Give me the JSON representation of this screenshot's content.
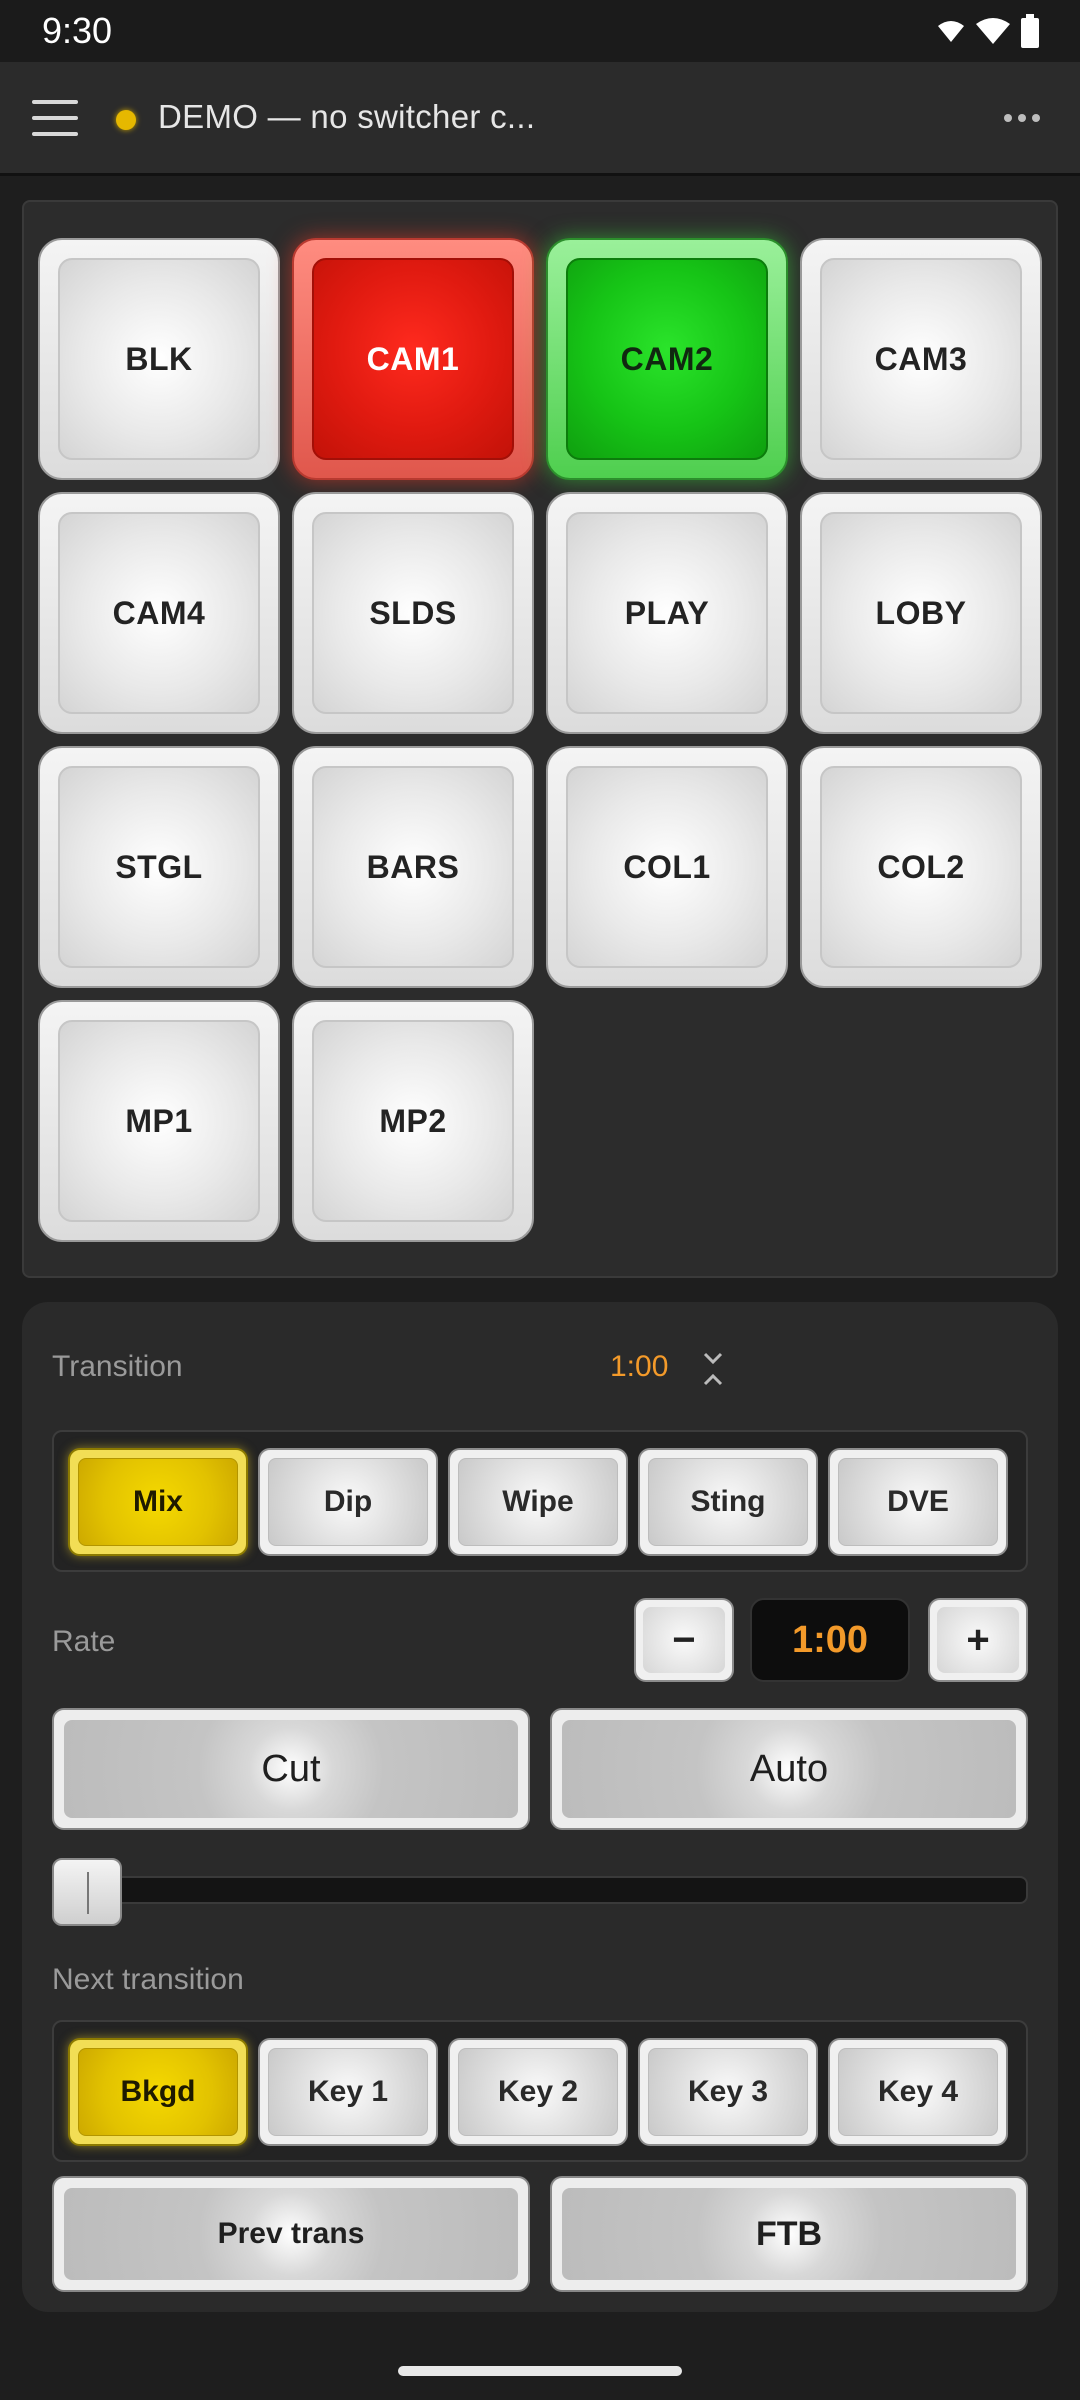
{
  "status_bar": {
    "time": "9:30",
    "icons": [
      "wifi-icon",
      "signal-icon",
      "battery-icon"
    ]
  },
  "app_bar": {
    "title": "DEMO — no switcher c...",
    "status_color": "#e6b800",
    "menu_icon": "hamburger-icon",
    "overflow_icon": "more-horizontal-icon"
  },
  "sources": [
    {
      "label": "BLK",
      "state": "none"
    },
    {
      "label": "CAM1",
      "state": "program"
    },
    {
      "label": "CAM2",
      "state": "preview"
    },
    {
      "label": "CAM3",
      "state": "none"
    },
    {
      "label": "CAM4",
      "state": "none"
    },
    {
      "label": "SLDS",
      "state": "none"
    },
    {
      "label": "PLAY",
      "state": "none"
    },
    {
      "label": "LOBY",
      "state": "none"
    },
    {
      "label": "STGL",
      "state": "none"
    },
    {
      "label": "BARS",
      "state": "none"
    },
    {
      "label": "COL1",
      "state": "none"
    },
    {
      "label": "COL2",
      "state": "none"
    },
    {
      "label": "MP1",
      "state": "none"
    },
    {
      "label": "MP2",
      "state": "none"
    }
  ],
  "transition": {
    "label": "Transition",
    "duration": "1:00",
    "styles": [
      {
        "label": "Mix",
        "active": true
      },
      {
        "label": "Dip",
        "active": false
      },
      {
        "label": "Wipe",
        "active": false
      },
      {
        "label": "Sting",
        "active": false
      },
      {
        "label": "DVE",
        "active": false
      }
    ],
    "rate_label": "Rate",
    "rate_value": "1:00",
    "decrement_label": "−",
    "increment_label": "+",
    "cut_label": "Cut",
    "auto_label": "Auto",
    "tbar_position": 0,
    "next_transition_label": "Next transition",
    "next_items": [
      {
        "label": "Bkgd",
        "active": true
      },
      {
        "label": "Key 1",
        "active": false
      },
      {
        "label": "Key 2",
        "active": false
      },
      {
        "label": "Key 3",
        "active": false
      },
      {
        "label": "Key 4",
        "active": false
      }
    ],
    "prev_trans_label": "Prev trans",
    "ftb_label": "FTB"
  },
  "colors": {
    "program": "#e01a10",
    "preview": "#16c416",
    "active_yellow": "#e2c200",
    "accent_orange": "#f39a2a"
  }
}
